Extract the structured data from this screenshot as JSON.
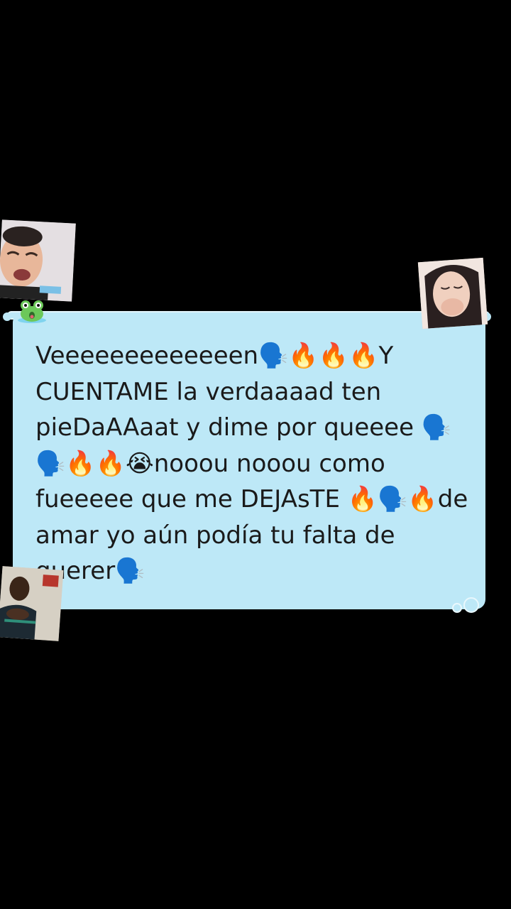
{
  "lyric": {
    "text": "Veeeeeeeeeeeeen🗣️🔥🔥🔥Y CUENTAME la verdaaaad ten pieDaAAaat y dime por queeee 🗣️🗣️🔥🔥😭nooou nooou como fueeeee que me DEJAsTE 🔥🗣️🔥de amar yo aún podía tu falta de querer🗣️"
  },
  "stickers": [
    {
      "name": "crying-baby-sticker",
      "icon": "crying-baby-photo"
    },
    {
      "name": "crying-girl-sticker",
      "icon": "crying-girl-photo"
    },
    {
      "name": "man-sticker",
      "icon": "man-praying-photo"
    }
  ],
  "decorations": {
    "frog_icon": "frog-icon",
    "bubbles_icon": "bubbles-icon"
  },
  "colors": {
    "background": "#000000",
    "bubble": "#bde8f7",
    "text": "#1a1a1a",
    "frog": "#6cc85a"
  }
}
